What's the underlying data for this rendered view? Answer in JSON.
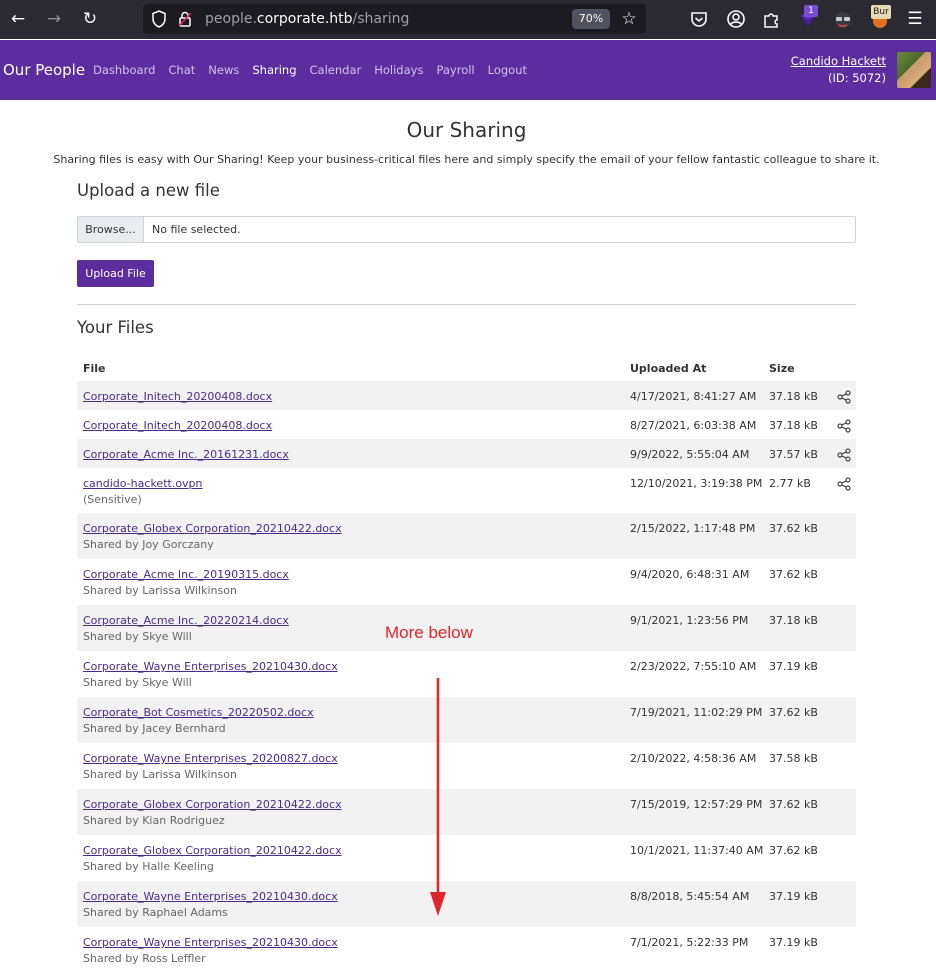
{
  "browser": {
    "url_prefix": "people.",
    "url_host": "corporate.htb",
    "url_path": "/sharing",
    "zoom": "70%",
    "ext_badge_count": "1",
    "ext_bur_label": "Bur"
  },
  "nav": {
    "brand": "Our People",
    "links": [
      "Dashboard",
      "Chat",
      "News",
      "Sharing",
      "Calendar",
      "Holidays",
      "Payroll",
      "Logout"
    ],
    "active": "Sharing",
    "user_name": "Candido Hackett",
    "user_id": "(ID: 5072)"
  },
  "page": {
    "title": "Our Sharing",
    "intro": "Sharing files is easy with Our Sharing! Keep your business-critical files here and simply specify the email of your fellow fantastic colleague to share it.",
    "upload_heading": "Upload a new file",
    "browse_label": "Browse...",
    "no_file_label": "No file selected.",
    "upload_button": "Upload File",
    "files_heading": "Your Files"
  },
  "table": {
    "headers": {
      "file": "File",
      "uploaded": "Uploaded At",
      "size": "Size"
    },
    "rows": [
      {
        "file": "Corporate_Initech_20200408.docx",
        "sub": "",
        "date": "4/17/2021, 8:41:27 AM",
        "size": "37.18 kB",
        "share": true
      },
      {
        "file": "Corporate_Initech_20200408.docx",
        "sub": "",
        "date": "8/27/2021, 6:03:38 AM",
        "size": "37.18 kB",
        "share": true
      },
      {
        "file": "Corporate_Acme Inc._20161231.docx",
        "sub": "",
        "date": "9/9/2022, 5:55:04 AM",
        "size": "37.57 kB",
        "share": true
      },
      {
        "file": "candido-hackett.ovpn",
        "sub": "(Sensitive)",
        "date": "12/10/2021, 3:19:38 PM",
        "size": "2.77 kB",
        "share": true
      },
      {
        "file": "Corporate_Globex Corporation_20210422.docx",
        "sub": "Shared by Joy Gorczany",
        "date": "2/15/2022, 1:17:48 PM",
        "size": "37.62 kB",
        "share": false
      },
      {
        "file": "Corporate_Acme Inc._20190315.docx",
        "sub": "Shared by Larissa Wilkinson",
        "date": "9/4/2020, 6:48:31 AM",
        "size": "37.62 kB",
        "share": false
      },
      {
        "file": "Corporate_Acme Inc._20220214.docx",
        "sub": "Shared by Skye Will",
        "date": "9/1/2021, 1:23:56 PM",
        "size": "37.18 kB",
        "share": false
      },
      {
        "file": "Corporate_Wayne Enterprises_20210430.docx",
        "sub": "Shared by Skye Will",
        "date": "2/23/2022, 7:55:10 AM",
        "size": "37.19 kB",
        "share": false
      },
      {
        "file": "Corporate_Bot Cosmetics_20220502.docx",
        "sub": "Shared by Jacey Bernhard",
        "date": "7/19/2021, 11:02:29 PM",
        "size": "37.62 kB",
        "share": false
      },
      {
        "file": "Corporate_Wayne Enterprises_20200827.docx",
        "sub": "Shared by Larissa Wilkinson",
        "date": "2/10/2022, 4:58:36 AM",
        "size": "37.58 kB",
        "share": false
      },
      {
        "file": "Corporate_Globex Corporation_20210422.docx",
        "sub": "Shared by Kian Rodriguez",
        "date": "7/15/2019, 12:57:29 PM",
        "size": "37.62 kB",
        "share": false
      },
      {
        "file": "Corporate_Globex Corporation_20210422.docx",
        "sub": "Shared by Halle Keeling",
        "date": "10/1/2021, 11:37:40 AM",
        "size": "37.62 kB",
        "share": false
      },
      {
        "file": "Corporate_Wayne Enterprises_20210430.docx",
        "sub": "Shared by Raphael Adams",
        "date": "8/8/2018, 5:45:54 AM",
        "size": "37.19 kB",
        "share": false
      },
      {
        "file": "Corporate_Wayne Enterprises_20210430.docx",
        "sub": "Shared by Ross Leffler",
        "date": "7/1/2021, 5:22:33 PM",
        "size": "37.19 kB",
        "share": false
      }
    ]
  },
  "annotation": {
    "text": "More below",
    "color": "#e0252b"
  },
  "colors": {
    "brand": "#5b2d9e",
    "link": "#4a2a8a",
    "stripe": "#f2f2f2"
  }
}
